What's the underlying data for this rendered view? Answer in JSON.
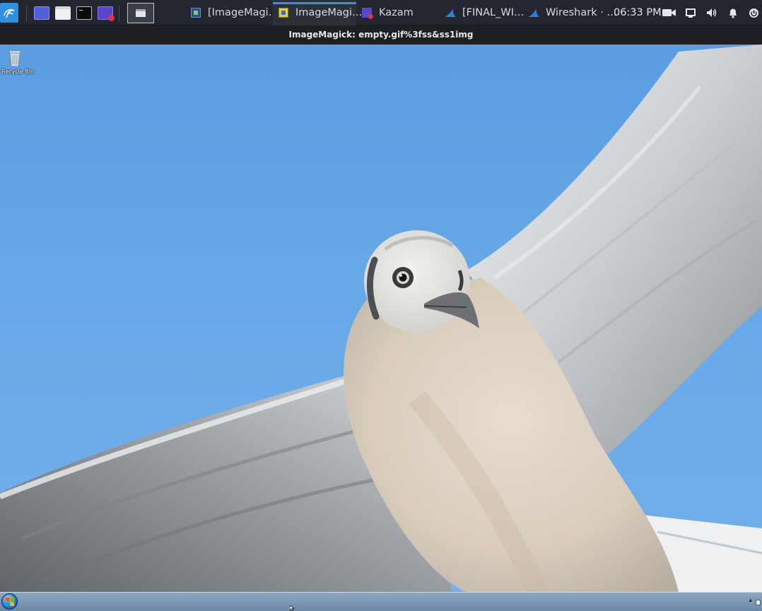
{
  "panel": {
    "launchers": [
      "show-desktop",
      "file-manager",
      "terminal",
      "kazam"
    ],
    "tasks": [
      {
        "label": "[ImageMagi…",
        "icon": "imagemagick-icon",
        "active": false
      },
      {
        "label": "ImageMagi…",
        "icon": "imagemagick-icon",
        "active": true
      },
      {
        "label": "Kazam",
        "icon": "kazam-icon",
        "active": false
      },
      {
        "label": "[FINAL_WI…",
        "icon": "wireshark-icon",
        "active": false
      },
      {
        "label": "Wireshark · …",
        "icon": "wireshark-icon",
        "active": false
      }
    ],
    "clock": "06:33 PM",
    "tray_icons": [
      "camera-icon",
      "window-icon",
      "volume-icon",
      "bell-icon",
      "power-icon"
    ],
    "accent_color": "#3d8ce6"
  },
  "window": {
    "title": "ImageMagick: empty.gif%3fss&ss1img"
  },
  "desktop": {
    "icons": [
      {
        "label": "Recycle Bin",
        "icon": "recycle-bin-icon"
      }
    ],
    "sky_color": "#66a7e6"
  },
  "taskbar": {
    "start_icon": "windows-start-icon",
    "tray_chevron": "▴"
  }
}
